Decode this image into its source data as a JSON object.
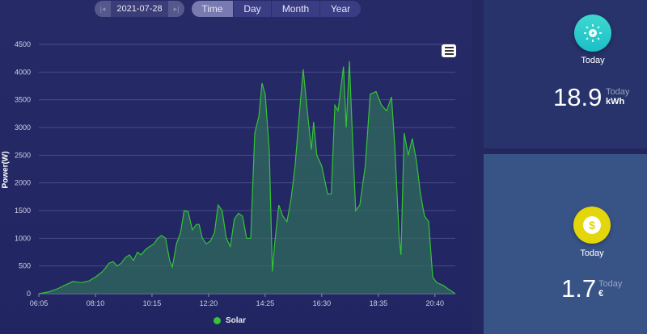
{
  "toolbar": {
    "date": "2021-07-28",
    "tabs": [
      "Time",
      "Day",
      "Month",
      "Year"
    ],
    "active_tab": "Time"
  },
  "cards": [
    {
      "label": "Today",
      "value": "18.9",
      "sub": "Today",
      "unit": "kWh",
      "icon": "sun-icon",
      "color": "#2ccfc9"
    },
    {
      "label": "Today",
      "value": "1.7",
      "sub": "Today",
      "unit": "€",
      "icon": "dollar-coin-icon",
      "color": "#e5d70a"
    }
  ],
  "chart_data": {
    "type": "area",
    "ylabel": "Power(W)",
    "xlabel": "",
    "ylim": [
      0,
      4500
    ],
    "yticks": [
      "0",
      "500",
      "1000",
      "1500",
      "2000",
      "2500",
      "3000",
      "3500",
      "4000",
      "4500"
    ],
    "xlim_minutes": [
      365,
      1285
    ],
    "xticks": [
      {
        "label": "06:05",
        "m": 365
      },
      {
        "label": "08:10",
        "m": 490
      },
      {
        "label": "10:15",
        "m": 615
      },
      {
        "label": "12:20",
        "m": 740
      },
      {
        "label": "14:25",
        "m": 865
      },
      {
        "label": "16:30",
        "m": 990
      },
      {
        "label": "18:35",
        "m": 1115
      },
      {
        "label": "20:40",
        "m": 1240
      }
    ],
    "grid": true,
    "legend_position": "bottom",
    "series": [
      {
        "name": "Solar",
        "color": "#35c435",
        "x_minutes": [
          365,
          386,
          404,
          422,
          440,
          458,
          476,
          490,
          503,
          511,
          520,
          529,
          538,
          547,
          556,
          565,
          574,
          583,
          591,
          601,
          610,
          619,
          628,
          636,
          645,
          654,
          660,
          669,
          678,
          686,
          695,
          704,
          713,
          719,
          726,
          735,
          744,
          753,
          761,
          770,
          779,
          788,
          797,
          806,
          815,
          824,
          833,
          842,
          851,
          858,
          865,
          874,
          881,
          886,
          895,
          904,
          913,
          922,
          931,
          940,
          949,
          958,
          967,
          972,
          979,
          990,
          1003,
          1011,
          1019,
          1026,
          1029,
          1038,
          1044,
          1051,
          1058,
          1065,
          1074,
          1086,
          1097,
          1110,
          1122,
          1133,
          1144,
          1151,
          1161,
          1165,
          1172,
          1181,
          1190,
          1199,
          1208,
          1217,
          1226,
          1235,
          1244,
          1258,
          1270,
          1285
        ],
        "values": [
          0,
          30,
          80,
          150,
          220,
          200,
          230,
          300,
          380,
          450,
          550,
          580,
          500,
          550,
          650,
          700,
          600,
          750,
          700,
          800,
          850,
          900,
          1000,
          1050,
          1000,
          600,
          480,
          900,
          1100,
          1500,
          1480,
          1150,
          1250,
          1250,
          1000,
          900,
          950,
          1100,
          1600,
          1500,
          1000,
          850,
          1350,
          1450,
          1400,
          1000,
          1000,
          2900,
          3200,
          3800,
          3600,
          2600,
          400,
          900,
          1600,
          1400,
          1300,
          1700,
          2300,
          3200,
          4050,
          3300,
          2600,
          3100,
          2500,
          2300,
          1800,
          1800,
          3400,
          3300,
          3500,
          4100,
          3000,
          4200,
          2800,
          1500,
          1600,
          2300,
          3600,
          3650,
          3400,
          3300,
          3550,
          2700,
          1000,
          700,
          2900,
          2500,
          2800,
          2400,
          1800,
          1400,
          1300,
          300,
          200,
          150,
          80,
          0
        ]
      }
    ]
  }
}
